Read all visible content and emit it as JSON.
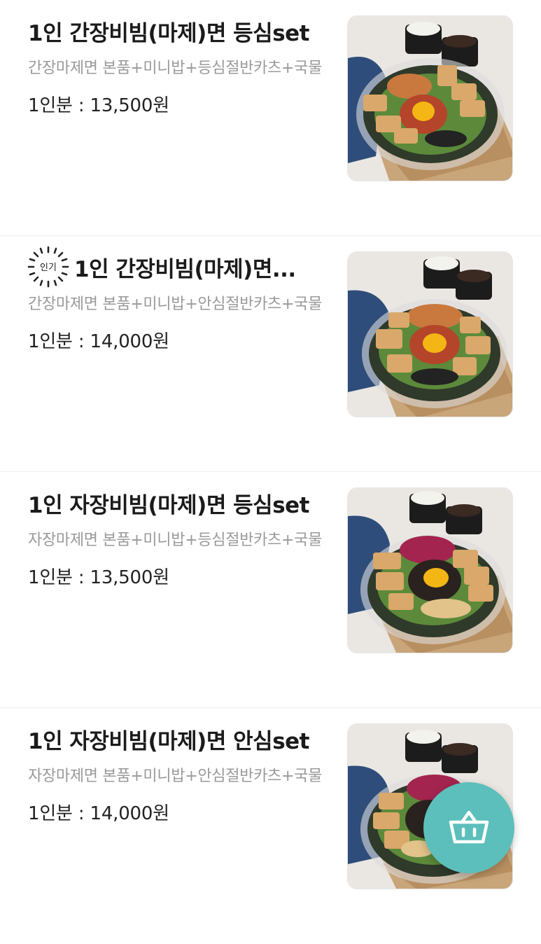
{
  "menu": {
    "items": [
      {
        "title": "1인 간장비빔(마제)면 등심set",
        "description": "간장마제면 본품+미니밥+등심절반카츠+국물",
        "price": "1인분 : 13,500원",
        "badge": "",
        "image": "soy-mazemen-loin-set-photo"
      },
      {
        "title": "1인 간장비빔(마제)면...",
        "description": "간장마제면 본품+미니밥+안심절반카츠+국물",
        "price": "1인분 : 14,000원",
        "badge": "인기",
        "image": "soy-mazemen-tenderloin-set-photo"
      },
      {
        "title": "1인 자장비빔(마제)면 등심set",
        "description": "자장마제면 본품+미니밥+등심절반카츠+국물",
        "price": "1인분 : 13,500원",
        "badge": "",
        "image": "jajang-mazemen-loin-set-photo"
      },
      {
        "title": "1인 자장비빔(마제)면 안심set",
        "description": "자장마제면 본품+미니밥+안심절반카츠+국물",
        "price": "1인분 : 14,000원",
        "badge": "",
        "image": "jajang-mazemen-tenderloin-set-photo"
      }
    ]
  },
  "cart_button": {
    "icon": "basket-icon",
    "color": "#5cbfbb"
  },
  "colors": {
    "accent": "#5cbfbb",
    "muted_text": "#9a9a9a",
    "divider": "#efefef"
  }
}
